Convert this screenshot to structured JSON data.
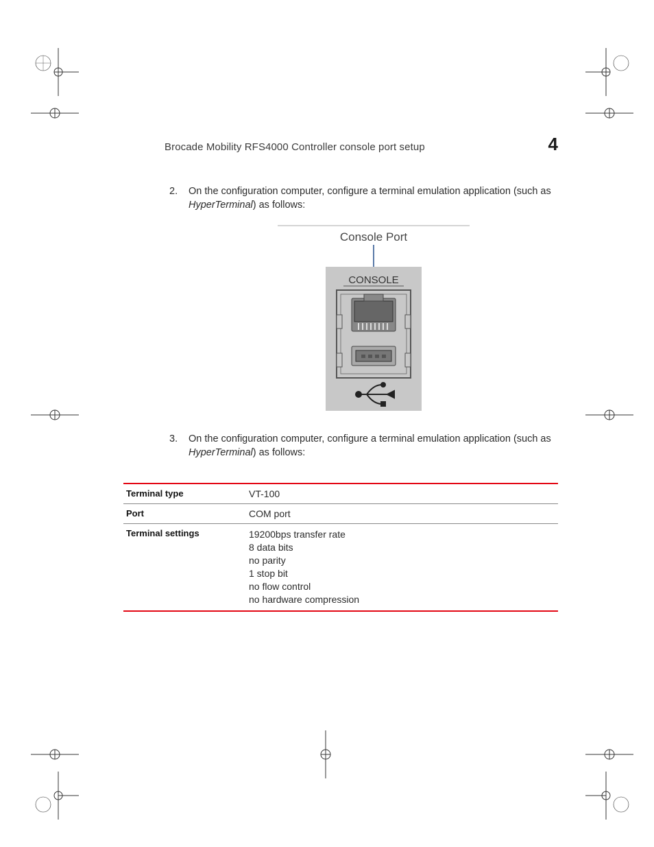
{
  "header": {
    "title": "Brocade Mobility RFS4000 Controller console port setup",
    "chapterNumber": "4"
  },
  "steps": {
    "two": {
      "num": "2.",
      "text_before": "On the configuration computer, configure a terminal emulation application (such as ",
      "text_italic": "HyperTerminal",
      "text_after": ") as follows:"
    },
    "three": {
      "num": "3.",
      "text_before": "On the configuration computer, configure a terminal emulation application (such as ",
      "text_italic": "HyperTerminal",
      "text_after": ") as follows:"
    }
  },
  "figure": {
    "title": "Console Port",
    "panelLabel": "CONSOLE"
  },
  "table": {
    "rows": [
      {
        "label": "Terminal type",
        "value": "VT-100"
      },
      {
        "label": "Port",
        "value": "COM port"
      },
      {
        "label": "Terminal settings",
        "values": [
          "19200bps transfer rate",
          "8 data bits",
          "no parity",
          "1 stop bit",
          "no flow control",
          "no hardware compression"
        ]
      }
    ]
  }
}
